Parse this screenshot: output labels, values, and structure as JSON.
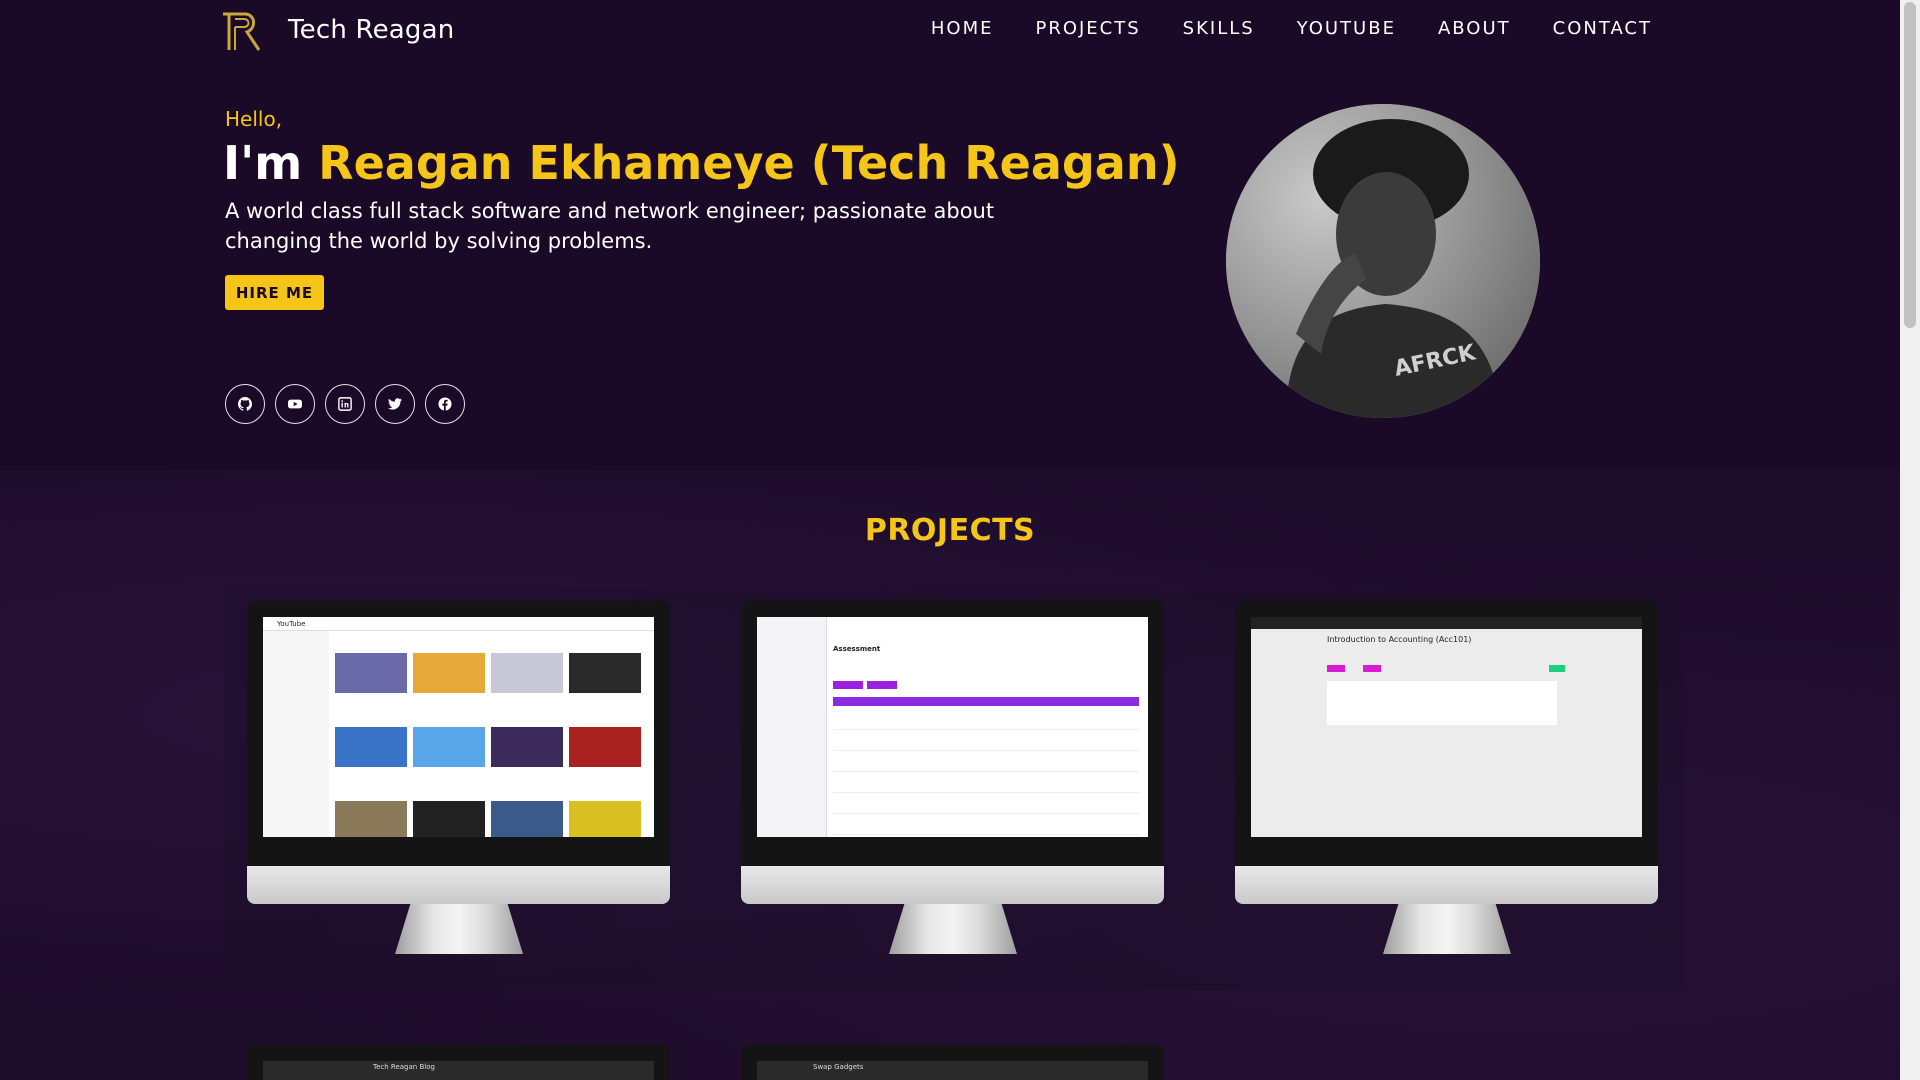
{
  "nav": {
    "brand": "Tech Reagan",
    "links": [
      "HOME",
      "PROJECTS",
      "SKILLS",
      "YOUTUBE",
      "ABOUT",
      "CONTACT"
    ]
  },
  "hero": {
    "greeting": "Hello,",
    "intro": "I'm",
    "name": "Reagan Ekhameye (Tech Reagan)",
    "tagline": "A world class full stack software and network engineer; passionate about changing the world by solving problems.",
    "cta": "HIRE ME",
    "socials": [
      "github-icon",
      "youtube-icon",
      "linkedin-icon",
      "twitter-icon",
      "facebook-icon"
    ]
  },
  "projects": {
    "title": "PROJECTS",
    "items": [
      {
        "screen_title": "YouTube"
      },
      {
        "screen_title": "Assessment"
      },
      {
        "screen_title": "Introduction to Accounting (Acc101)"
      },
      {
        "screen_title": "Tech Reagan Blog"
      },
      {
        "screen_title": "Swap Gadgets"
      }
    ]
  },
  "colors": {
    "background": "#1b0a27",
    "accent": "#f5c518",
    "text": "#ffffff"
  }
}
